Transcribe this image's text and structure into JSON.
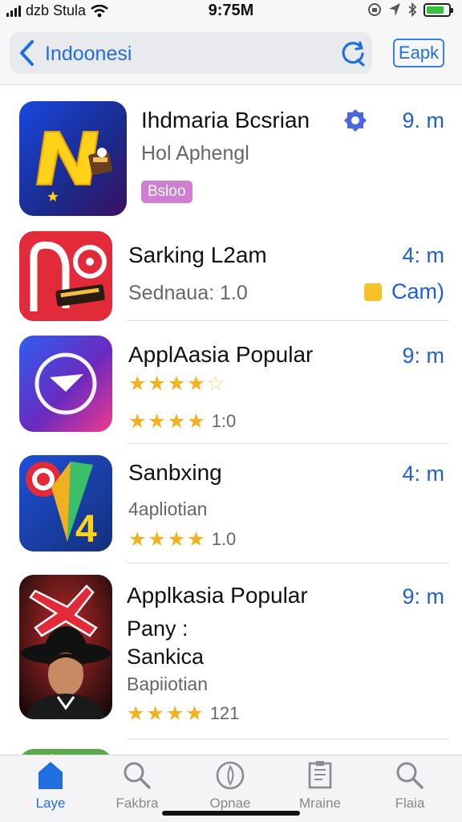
{
  "status_bar": {
    "carrier": "dzb Stula",
    "time": "9:75M",
    "battery_color": "#37c23e"
  },
  "header": {
    "search_text": "Indoonesi",
    "button_label": "Eapk",
    "accent": "#1f6fe0"
  },
  "apps": [
    {
      "name": "Ihdmaria Bcsrian",
      "sub": "Hol Aphengl",
      "badge": "Bsloo",
      "time": "9. m",
      "icon": "n-logo-icon"
    },
    {
      "name": "Sarking L2am",
      "sub": "Sednaua: 1.0",
      "time": "4: m",
      "action_label": "Cam)",
      "icon": "red-ring-icon"
    },
    {
      "name": "ApplAasia Popular",
      "rating_text": "1:0",
      "time": "9: m",
      "icon": "play-circle-icon"
    },
    {
      "name": "Sanbxing",
      "sub": "4apliotian",
      "rating_text": "1.0",
      "time": "4: m",
      "icon": "target-kite-icon"
    },
    {
      "name": "Applkasia Popular",
      "line2": "Pany :",
      "line3": "Sankica",
      "sub": "Bapiiotian",
      "rating_text": "121",
      "time": "9: m",
      "icon": "portrait-icon"
    }
  ],
  "tabs": [
    {
      "label": "Laye",
      "icon": "home-icon",
      "active": true
    },
    {
      "label": "Fakbra",
      "icon": "search-icon"
    },
    {
      "label": "Opnae",
      "icon": "compass-icon"
    },
    {
      "label": "Mraine",
      "icon": "document-icon"
    },
    {
      "label": "Flaia",
      "icon": "search-icon"
    }
  ]
}
